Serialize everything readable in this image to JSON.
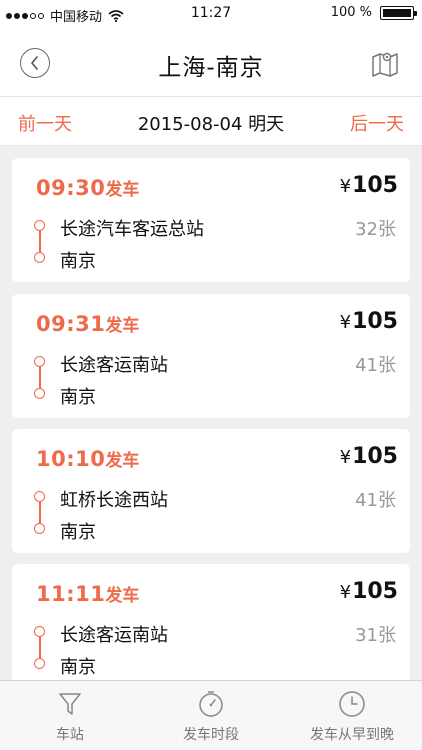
{
  "status_bar": {
    "carrier": "中国移动",
    "time": "11:27",
    "battery": "100 %"
  },
  "header": {
    "title": "上海-南京",
    "back_icon": "back-chevron-icon",
    "map_icon": "map-icon"
  },
  "date_bar": {
    "prev_label": "前一天",
    "date": "2015-08-04 明天",
    "next_label": "后一天"
  },
  "trips": [
    {
      "time": "09:30",
      "suffix": "发车",
      "currency": "¥",
      "price": "105",
      "station": "长途汽车客运总站",
      "destination": "南京",
      "seats": "32张"
    },
    {
      "time": "09:31",
      "suffix": "发车",
      "currency": "¥",
      "price": "105",
      "station": "长途客运南站",
      "destination": "南京",
      "seats": "41张"
    },
    {
      "time": "10:10",
      "suffix": "发车",
      "currency": "¥",
      "price": "105",
      "station": "虹桥长途西站",
      "destination": "南京",
      "seats": "41张"
    },
    {
      "time": "11:11",
      "suffix": "发车",
      "currency": "¥",
      "price": "105",
      "station": "长途客运南站",
      "destination": "南京",
      "seats": "31张"
    }
  ],
  "tab_bar": {
    "tabs": [
      {
        "label": "车站",
        "icon": "filter-icon"
      },
      {
        "label": "发车时段",
        "icon": "timer-icon"
      },
      {
        "label": "发车从早到晚",
        "icon": "clock-icon"
      }
    ]
  },
  "colors": {
    "accent": "#ef6a4a",
    "background": "#efefef"
  }
}
